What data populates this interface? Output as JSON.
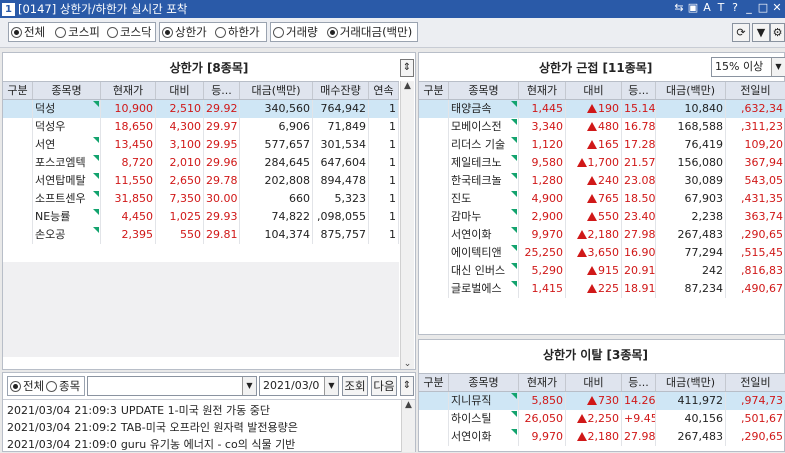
{
  "window": {
    "title": "[0147] 상한가/하한가 실시간 포착",
    "number": "1"
  },
  "title_icons": [
    "link-icon",
    "image-icon",
    "font-icon",
    "text-icon",
    "help-icon",
    "minimize-icon",
    "restore-icon",
    "close-icon"
  ],
  "toolbar": {
    "market": [
      {
        "label": "전체",
        "checked": true
      },
      {
        "label": "코스피",
        "checked": false
      },
      {
        "label": "코스닥",
        "checked": false
      }
    ],
    "limit": [
      {
        "label": "상한가",
        "checked": true
      },
      {
        "label": "하한가",
        "checked": false
      }
    ],
    "sort": [
      {
        "label": "거래량",
        "checked": false
      },
      {
        "label": "거래대금(백만)",
        "checked": true
      }
    ]
  },
  "left": {
    "title": "상한가 [8종목]",
    "columns": [
      "구분",
      "종목명",
      "현재가",
      "대비",
      "등...",
      "대금(백만)",
      "매수잔량",
      "연속"
    ],
    "rows": [
      {
        "type": "",
        "name": "덕성",
        "price": "10,900",
        "diff": "2,510",
        "rate": "29.92",
        "amount": "340,560",
        "bid": "764,942",
        "streak": "1",
        "mark": true,
        "sel": true
      },
      {
        "type": "",
        "name": "덕성우",
        "price": "18,650",
        "diff": "4,300",
        "rate": "29.97",
        "amount": "6,906",
        "bid": "71,849",
        "streak": "1",
        "mark": false
      },
      {
        "type": "",
        "name": "서연",
        "price": "13,450",
        "diff": "3,100",
        "rate": "29.95",
        "amount": "577,657",
        "bid": "301,534",
        "streak": "1",
        "mark": true
      },
      {
        "type": "",
        "name": "포스코엠텍",
        "price": "8,720",
        "diff": "2,010",
        "rate": "29.96",
        "amount": "284,645",
        "bid": "647,604",
        "streak": "1",
        "mark": true
      },
      {
        "type": "",
        "name": "서연탑메탈",
        "price": "11,550",
        "diff": "2,650",
        "rate": "29.78",
        "amount": "202,808",
        "bid": "894,478",
        "streak": "1",
        "mark": true
      },
      {
        "type": "",
        "name": "소프트센우",
        "price": "31,850",
        "diff": "7,350",
        "rate": "30.00",
        "amount": "660",
        "bid": "5,323",
        "streak": "1",
        "mark": true
      },
      {
        "type": "",
        "name": "NE능률",
        "price": "4,450",
        "diff": "1,025",
        "rate": "29.93",
        "amount": "74,822",
        "bid": ",098,055",
        "streak": "1",
        "mark": true
      },
      {
        "type": "",
        "name": "손오공",
        "price": "2,395",
        "diff": "550",
        "rate": "29.81",
        "amount": "104,374",
        "bid": "875,757",
        "streak": "1",
        "mark": true
      }
    ]
  },
  "near": {
    "title": "상한가 근접 [11종목]",
    "filter": "15% 이상",
    "columns": [
      "구분",
      "종목명",
      "현재가",
      "대비",
      "등...",
      "대금(백만)",
      "전일비"
    ],
    "rows": [
      {
        "name": "태양금속",
        "price": "1,445",
        "diff": "190",
        "rate": "15.14",
        "amount": "10,840",
        "prev": ",632,34",
        "up": true,
        "sel": true
      },
      {
        "name": "모베이스전",
        "price": "3,340",
        "diff": "480",
        "rate": "16.78",
        "amount": "168,588",
        "prev": ",311,23",
        "up": true
      },
      {
        "name": "리더스 기술",
        "price": "1,120",
        "diff": "165",
        "rate": "17.28",
        "amount": "76,419",
        "prev": "109,20",
        "up": true
      },
      {
        "name": "제일테크노",
        "price": "9,580",
        "diff": "1,700",
        "rate": "21.57",
        "amount": "156,080",
        "prev": "367,94",
        "up": true
      },
      {
        "name": "한국테크놀",
        "price": "1,280",
        "diff": "240",
        "rate": "23.08",
        "amount": "30,089",
        "prev": "543,05",
        "up": true
      },
      {
        "name": "진도",
        "price": "4,900",
        "diff": "765",
        "rate": "18.50",
        "amount": "67,903",
        "prev": ",431,35",
        "up": true
      },
      {
        "name": "감마누",
        "price": "2,900",
        "diff": "550",
        "rate": "23.40",
        "amount": "2,238",
        "prev": "363,74",
        "up": true
      },
      {
        "name": "서연이화",
        "price": "9,970",
        "diff": "2,180",
        "rate": "27.98",
        "amount": "267,483",
        "prev": ",290,65",
        "up": true
      },
      {
        "name": "에이텍티앤",
        "price": "25,250",
        "diff": "3,650",
        "rate": "16.90",
        "amount": "77,294",
        "prev": ",515,45",
        "up": true
      },
      {
        "name": "대신 인버스",
        "price": "5,290",
        "diff": "915",
        "rate": "20.91",
        "amount": "242",
        "prev": ",816,83",
        "up": true
      },
      {
        "name": "글로벌에스",
        "price": "1,415",
        "diff": "225",
        "rate": "18.91",
        "amount": "87,234",
        "prev": ",490,67",
        "up": true
      }
    ]
  },
  "left_limit": {
    "title": "상한가 이탈 [3종목]",
    "columns": [
      "구분",
      "종목명",
      "현재가",
      "대비",
      "등...",
      "대금(백만)",
      "전일비"
    ],
    "rows": [
      {
        "name": "지니뮤직",
        "price": "5,850",
        "diff": "730",
        "rate": "14.26",
        "amount": "411,972",
        "prev": ",974,73",
        "up": true,
        "sel": true
      },
      {
        "name": "하이스틸",
        "price": "26,050",
        "diff": "2,250",
        "rate": "+9.45",
        "amount": "40,156",
        "prev": ",501,67",
        "up": true
      },
      {
        "name": "서연이화",
        "price": "9,970",
        "diff": "2,180",
        "rate": "27.98",
        "amount": "267,483",
        "prev": ",290,65",
        "up": true
      }
    ]
  },
  "newsbar": {
    "all_label": "전체",
    "stock_label": "종목",
    "date": "2021/03/0",
    "search": "조회",
    "next": "다음"
  },
  "news": [
    {
      "date": "2021/03/04",
      "time": "21:09:3",
      "text": "UPDATE 1-미국 원전 가동 중단"
    },
    {
      "date": "2021/03/04",
      "time": "21:09:2",
      "text": "TAB-미국 오프라인 원자력 발전용량은"
    },
    {
      "date": "2021/03/04",
      "time": "21:09:0",
      "text": "guru 유기농 에너지 - co의 식물 기반"
    }
  ]
}
